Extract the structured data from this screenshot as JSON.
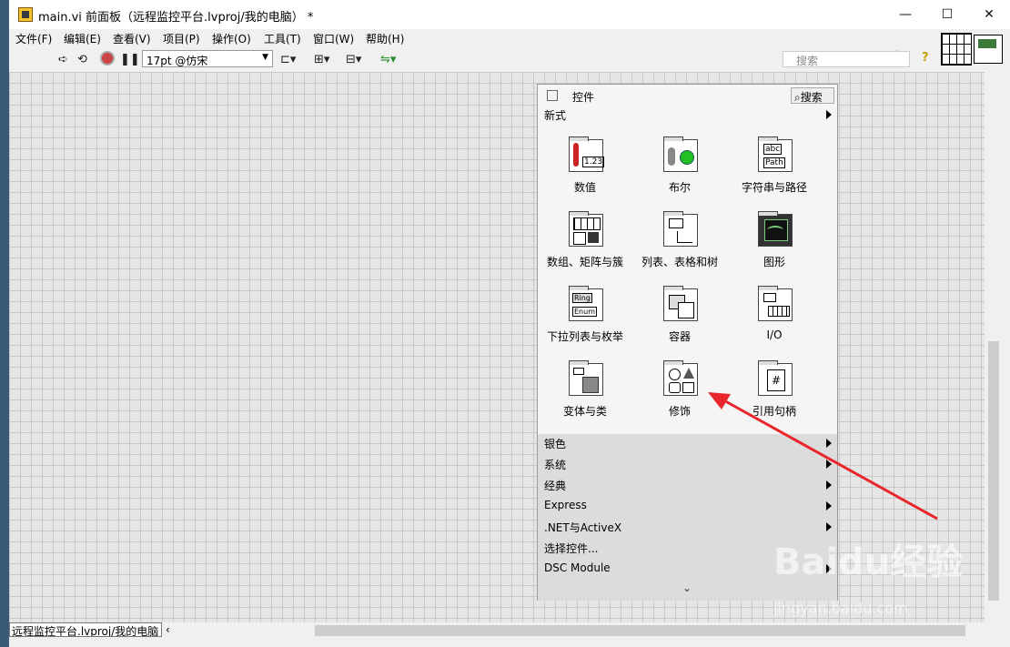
{
  "window": {
    "title": "main.vi 前面板（远程监控平台.lvproj/我的电脑） *",
    "minimize": "—",
    "maximize": "☐",
    "close": "✕"
  },
  "menu": [
    "文件(F)",
    "编辑(E)",
    "查看(V)",
    "项目(P)",
    "操作(O)",
    "工具(T)",
    "窗口(W)",
    "帮助(H)"
  ],
  "toolbar": {
    "font": "17pt @仿宋",
    "search_placeholder": "搜索",
    "help": "?"
  },
  "status": {
    "path": "远程监控平台.lvproj/我的电脑"
  },
  "palette": {
    "title": "控件",
    "search": "搜索",
    "category": "新式",
    "tiles": [
      "数值",
      "布尔",
      "字符串与路径",
      "数组、矩阵与簇",
      "列表、表格和树",
      "图形",
      "下拉列表与枚举",
      "容器",
      "I/O",
      "变体与类",
      "修饰",
      "引用句柄"
    ],
    "icon_texts": {
      "numeric": "1.23",
      "string_abc": "abc",
      "string_path": "Path",
      "ring": "Ring",
      "enum": "Enum",
      "refnum": "#"
    },
    "list": [
      "银色",
      "系统",
      "经典",
      "Express",
      ".NET与ActiveX",
      "选择控件...",
      "DSC Module"
    ],
    "more": "⌄"
  },
  "watermark": {
    "brand": "Baidu经验",
    "url": "jingyan.baidu.com"
  },
  "colors": {
    "annotation_arrow": "#e8262b",
    "canvas_grid": "#c8c8c8",
    "boolean_led": "#22c022"
  }
}
